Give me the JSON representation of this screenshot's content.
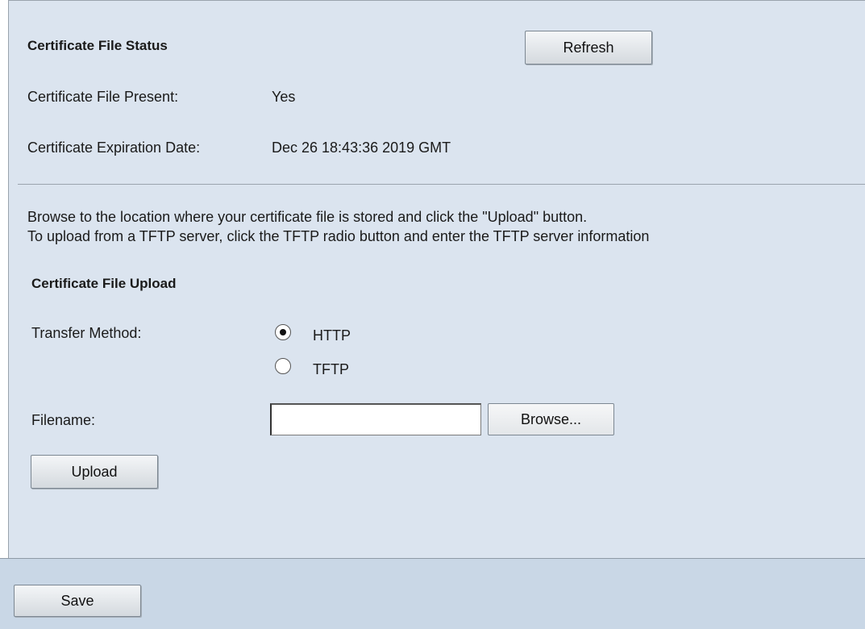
{
  "status_section": {
    "title": "Certificate File Status",
    "refresh_label": "Refresh",
    "file_present_label": "Certificate File Present:",
    "file_present_value": "Yes",
    "expiration_label": "Certificate Expiration Date:",
    "expiration_value": "Dec 26 18:43:36 2019 GMT"
  },
  "instructions": {
    "line1": "Browse to the location where your certificate file is stored and click the \"Upload\" button.",
    "line2": "To upload from a TFTP server, click the TFTP radio button and enter the TFTP server information"
  },
  "upload_section": {
    "title": "Certificate File Upload",
    "transfer_method_label": "Transfer Method:",
    "options": [
      {
        "label": "HTTP",
        "selected": true
      },
      {
        "label": "TFTP",
        "selected": false
      }
    ],
    "filename_label": "Filename:",
    "filename_value": "",
    "browse_label": "Browse...",
    "upload_label": "Upload"
  },
  "footer": {
    "save_label": "Save"
  },
  "colors": {
    "panel_background": "#dbe4ef",
    "footer_background": "#c9d7e6"
  }
}
